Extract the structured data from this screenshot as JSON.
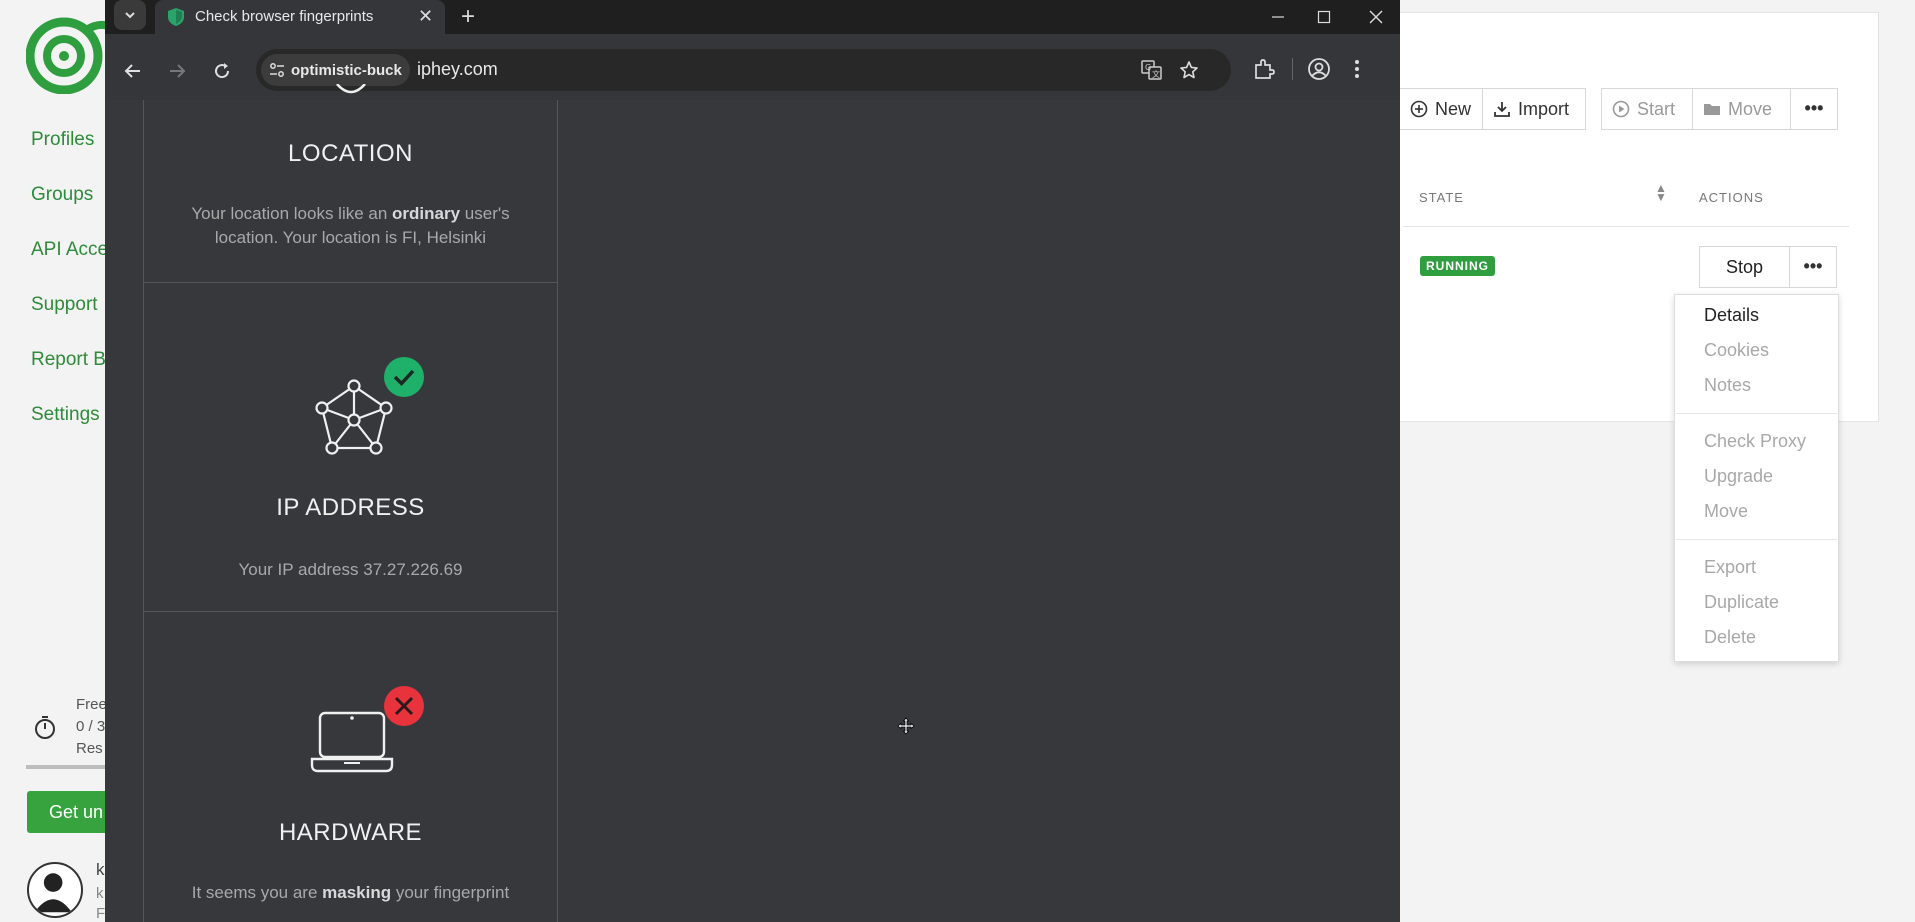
{
  "background_app": {
    "nav": [
      "Profiles",
      "Groups",
      "API Acce",
      "Support",
      "Report B",
      "Settings"
    ],
    "quota": {
      "line1": "Free",
      "line2": "0 / 3",
      "line3": "Res"
    },
    "upgrade_label": "Get un",
    "user": {
      "line1": "k",
      "line2": "k",
      "line3": "F"
    },
    "toolbar": {
      "new": "New",
      "import": "Import",
      "start": "Start",
      "move": "Move",
      "more": "•••"
    },
    "table": {
      "state_header": "STATE",
      "actions_header": "ACTIONS",
      "row_state": "RUNNING",
      "stop": "Stop",
      "more": "•••"
    },
    "menu": {
      "details": "Details",
      "cookies": "Cookies",
      "notes": "Notes",
      "check_proxy": "Check Proxy",
      "upgrade": "Upgrade",
      "move": "Move",
      "export": "Export",
      "duplicate": "Duplicate",
      "delete": "Delete"
    },
    "colors": {
      "brand_green": "#2e8b3a",
      "running_badge": "#2e9e3e"
    }
  },
  "browser": {
    "tab_title": "Check browser fingerprints",
    "site_chip": "optimistic-buck",
    "url": "iphey.com",
    "icons": [
      "tab-search-icon",
      "shield-favicon-icon",
      "close-icon",
      "plus-icon",
      "minimize-icon",
      "maximize-icon",
      "close-window-icon",
      "back-icon",
      "forward-icon",
      "reload-icon",
      "site-info-icon",
      "translate-icon",
      "star-icon",
      "extensions-icon",
      "profile-icon",
      "menu-icon"
    ]
  },
  "page": {
    "location": {
      "title": "LOCATION",
      "desc_pre": "Your location looks like an ",
      "desc_bold": "ordinary",
      "desc_post": " user's location. Your location is FI, Helsinki"
    },
    "ip": {
      "title": "IP ADDRESS",
      "desc": "Your IP address 37.27.226.69",
      "status": "ok"
    },
    "hardware": {
      "title": "HARDWARE",
      "desc_pre": "It seems you are ",
      "desc_bold": "masking",
      "desc_post": " your fingerprint",
      "status": "error"
    }
  }
}
